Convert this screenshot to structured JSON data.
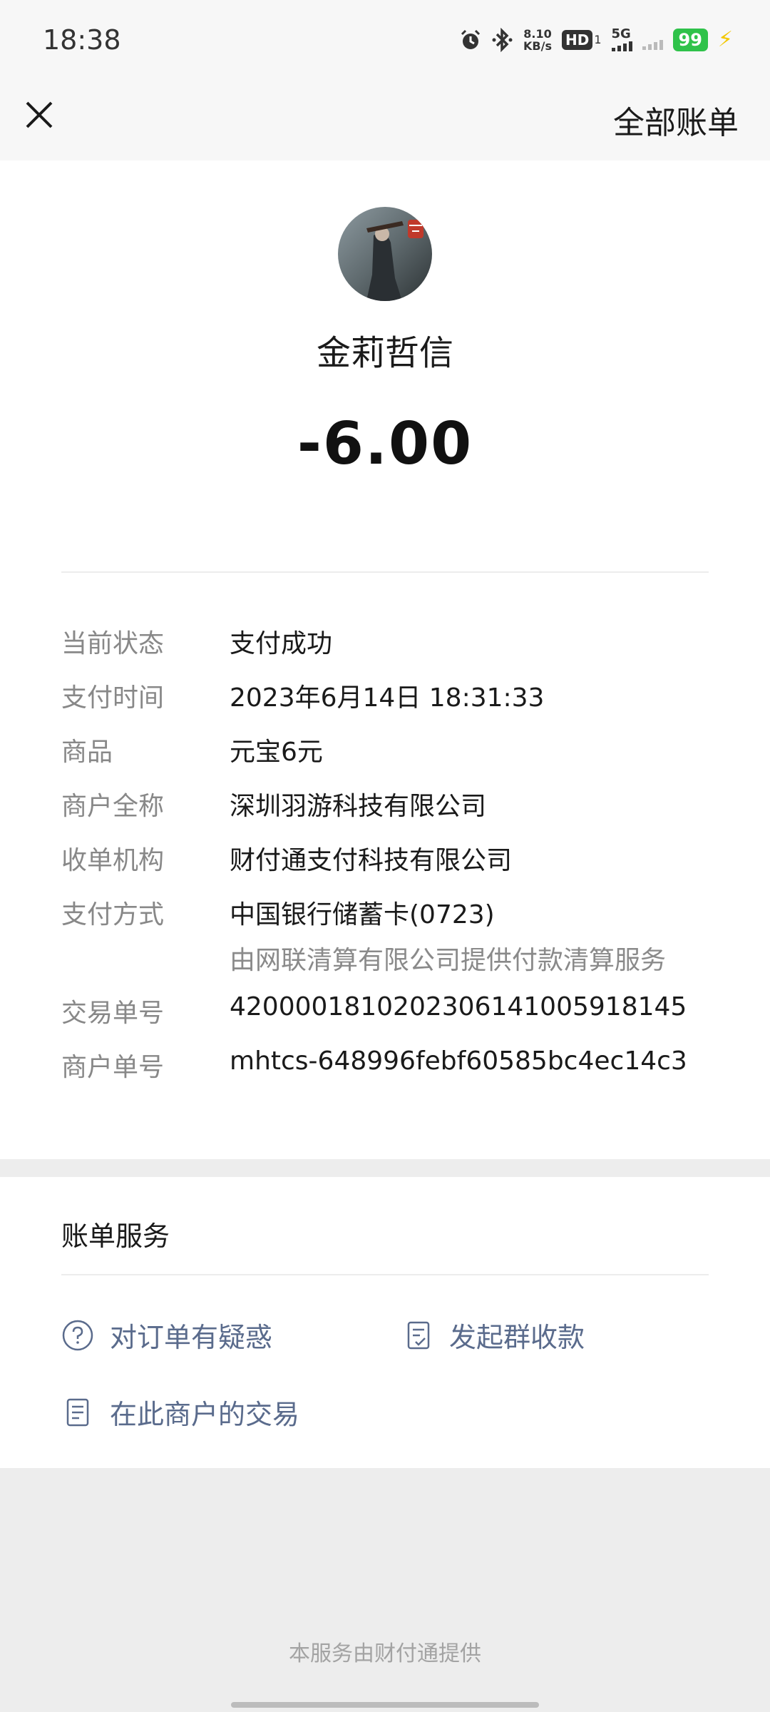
{
  "status_bar": {
    "time": "18:38",
    "net_speed_top": "8.10",
    "net_speed_bottom": "KB/s",
    "hd_label": "HD",
    "hd_sub": "1",
    "network": "5G",
    "battery": "99",
    "icons": [
      "alarm-icon",
      "bluetooth-icon",
      "signal-icon",
      "lightning-icon"
    ]
  },
  "nav": {
    "close_icon": "close-icon",
    "all_bills": "全部账单"
  },
  "payment": {
    "merchant_name": "金莉哲信",
    "amount": "-6.00"
  },
  "details": [
    {
      "label": "当前状态",
      "value": "支付成功"
    },
    {
      "label": "支付时间",
      "value": "2023年6月14日 18:31:33"
    },
    {
      "label": "商品",
      "value": "元宝6元"
    },
    {
      "label": "商户全称",
      "value": "深圳羽游科技有限公司"
    },
    {
      "label": "收单机构",
      "value": "财付通支付科技有限公司"
    },
    {
      "label": "支付方式",
      "value": "中国银行储蓄卡(0723)",
      "sub": "由网联清算有限公司提供付款清算服务"
    },
    {
      "label": "交易单号",
      "value": "4200001810202306141005918145"
    },
    {
      "label": "商户单号",
      "value": "mhtcs-648996febf60585bc4ec14c3"
    }
  ],
  "services": {
    "title": "账单服务",
    "items": [
      {
        "label": "对订单有疑惑",
        "icon": "question-icon"
      },
      {
        "label": "发起群收款",
        "icon": "group-collect-icon"
      },
      {
        "label": "在此商户的交易",
        "icon": "document-icon"
      }
    ]
  },
  "footer": "本服务由财付通提供",
  "colors": {
    "accent_link": "#5a6b8c",
    "battery": "#2fc24a",
    "background": "#ededed"
  }
}
